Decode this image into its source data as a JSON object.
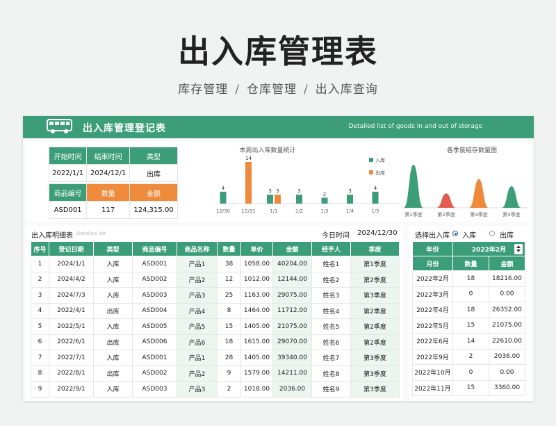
{
  "page": {
    "title": "出入库管理表",
    "breadcrumb": [
      "库存管理",
      "仓库管理",
      "出入库查询"
    ],
    "breadcrumb_sep": "/"
  },
  "header": {
    "title": "出入库管理登记表",
    "subtitle": "Detailed list of goods in and out of storage",
    "icon": "bus-icon"
  },
  "info": {
    "start_label": "开始时间",
    "end_label": "结束时间",
    "type_label": "类型",
    "start_value": "2022/1/1",
    "end_value": "2024/12/1",
    "type_value": "出库",
    "code_label": "商品编号",
    "qty_label": "数量",
    "amount_label": "金额",
    "code_value": "ASD001",
    "qty_value": "117",
    "amount_value": "124,315.00"
  },
  "colors": {
    "green": "#3c9e78",
    "orange": "#ee8a3a",
    "red": "#e35a4e"
  },
  "chart_data": [
    {
      "type": "bar",
      "title": "本周出入库数量统计",
      "categories": [
        "12/30",
        "12/31",
        "1/1",
        "1/2",
        "1/3",
        "1/4",
        "1/5"
      ],
      "series": [
        {
          "name": "入库",
          "values": [
            4,
            0,
            3,
            0,
            0,
            0,
            0
          ]
        },
        {
          "name": "出库",
          "values": [
            0,
            14,
            3,
            3,
            2,
            3,
            4
          ]
        }
      ],
      "labels": [
        "4",
        "14",
        "3",
        "3",
        "3",
        "2",
        "3",
        "4"
      ],
      "legend": "right"
    },
    {
      "type": "area",
      "title": "各季度结存数量图",
      "categories": [
        "第1季度",
        "第2季度",
        "第3季度",
        "第4季度"
      ],
      "values": [
        6,
        2,
        4,
        3
      ],
      "colors": [
        "#3c9e78",
        "#e35a4e",
        "#ee8a3a",
        "#3c9e78"
      ]
    }
  ],
  "detail": {
    "title": "出入库明细表",
    "subtitle": "Detailed list",
    "today_label": "今日时间",
    "today_value": "2024/12/30",
    "columns": [
      "序号",
      "登记日期",
      "类型",
      "商品编号",
      "商品名称",
      "数量",
      "单价",
      "金额",
      "经手人",
      "季度"
    ],
    "rows": [
      [
        "1",
        "2024/1/1",
        "入库",
        "ASD001",
        "产品1",
        "38",
        "1058.00",
        "40204.00",
        "姓名1",
        "第1季度"
      ],
      [
        "2",
        "2024/4/2",
        "入库",
        "ASD002",
        "产品2",
        "12",
        "1012.00",
        "12144.00",
        "姓名2",
        "第2季度"
      ],
      [
        "3",
        "2024/7/3",
        "入库",
        "ASD003",
        "产品3",
        "25",
        "1163.00",
        "29075.00",
        "姓名3",
        "第3季度"
      ],
      [
        "4",
        "2022/4/1",
        "出库",
        "ASD004",
        "产品4",
        "8",
        "1464.00",
        "11712.00",
        "姓名4",
        "第2季度"
      ],
      [
        "5",
        "2022/5/1",
        "入库",
        "ASD005",
        "产品5",
        "15",
        "1405.00",
        "21075.00",
        "姓名5",
        "第2季度"
      ],
      [
        "6",
        "2022/6/1",
        "出库",
        "ASD006",
        "产品6",
        "18",
        "1615.00",
        "29070.00",
        "姓名6",
        "第2季度"
      ],
      [
        "7",
        "2022/7/1",
        "入库",
        "ASD001",
        "产品1",
        "28",
        "1405.00",
        "39340.00",
        "姓名7",
        "第3季度"
      ],
      [
        "8",
        "2022/8/1",
        "出库",
        "ASD002",
        "产品2",
        "9",
        "1579.00",
        "14211.00",
        "姓名8",
        "第3季度"
      ],
      [
        "9",
        "2022/9/1",
        "入库",
        "ASD003",
        "产品3",
        "2",
        "1018.00",
        "2036.00",
        "姓名9",
        "第3季度"
      ]
    ]
  },
  "side": {
    "title": "选择出入库",
    "option_in": "入库",
    "option_out": "出库",
    "selected": "入库",
    "year_label": "年份",
    "year_value": "2022年2月",
    "columns": [
      "月份",
      "数量",
      "金额"
    ],
    "rows": [
      [
        "2022年2月",
        "18",
        "18216.00"
      ],
      [
        "2022年3月",
        "0",
        "0.00"
      ],
      [
        "2022年4月",
        "18",
        "26352.00"
      ],
      [
        "2022年5月",
        "15",
        "21075.00"
      ],
      [
        "2022年6月",
        "14",
        "22610.00"
      ],
      [
        "2022年9月",
        "2",
        "2036.00"
      ],
      [
        "2022年10月",
        "0",
        "0.00"
      ],
      [
        "2022年11月",
        "15",
        "3360.00"
      ]
    ]
  }
}
